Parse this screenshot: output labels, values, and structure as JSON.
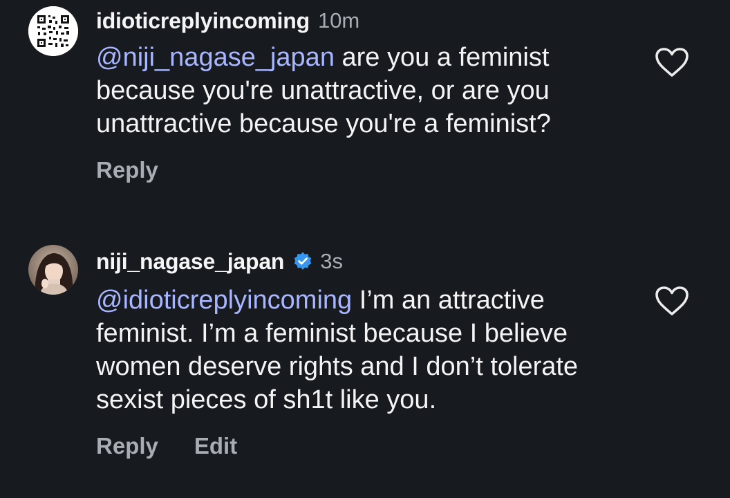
{
  "comments": [
    {
      "username": "idioticreplyincoming",
      "time": "10m",
      "verified": false,
      "mention": "@niji_nagase_japan",
      "text": " are you a feminist because you're unattractive, or are you unattractive because you're a feminist?",
      "actions": {
        "reply": "Reply"
      },
      "avatar_icon": "qr-code-avatar-icon",
      "like_icon": "heart-outline-icon"
    },
    {
      "username": "niji_nagase_japan",
      "time": "3s",
      "verified": true,
      "mention": "@idioticreplyincoming",
      "text": " I’m an attractive feminist. I’m a feminist because I believe women deserve rights and I don’t tolerate sexist pieces of sh1t like you.",
      "actions": {
        "reply": "Reply",
        "edit": "Edit"
      },
      "avatar_icon": "profile-photo-avatar",
      "like_icon": "heart-outline-icon"
    }
  ],
  "colors": {
    "background": "#171b20",
    "mention": "#a7b6ff",
    "muted": "#a8adb4",
    "verified": "#3797f0"
  }
}
